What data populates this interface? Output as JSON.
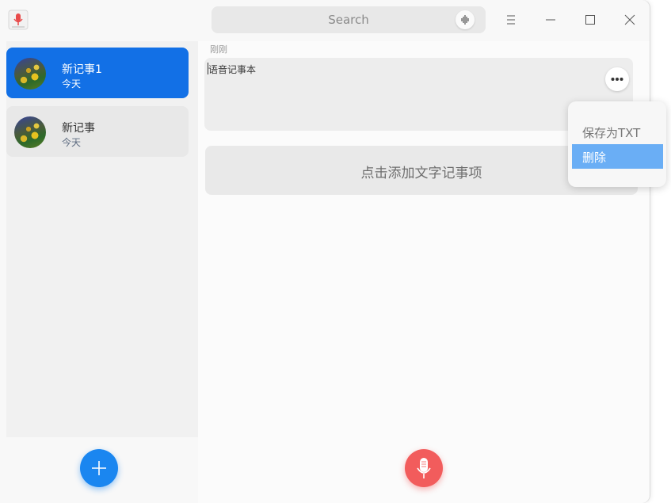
{
  "window": {
    "app_icon": "microphone-app-icon",
    "search": {
      "placeholder": "Search",
      "voice_icon": "voice-wave-icon"
    },
    "controls": [
      "menu-icon",
      "minimize-icon",
      "maximize-icon",
      "close-icon"
    ]
  },
  "sidebar": {
    "notes": [
      {
        "title": "新记事1",
        "date": "今天",
        "selected": true
      },
      {
        "title": "新记事",
        "date": "今天",
        "selected": false
      }
    ],
    "add_button_icon": "plus-icon"
  },
  "main": {
    "time_label": "刚刚",
    "voice_note_text": "语音记事本",
    "more_icon": "more-icon",
    "add_text_label": "点击添加文字记事项",
    "record_button_icon": "microphone-icon"
  },
  "context_menu": {
    "items": [
      "保存为TXT",
      "删除"
    ],
    "highlighted": "删除"
  },
  "colors": {
    "accent": "#1270e6",
    "add_button": "#1a86f0",
    "record_button": "#f25c5c",
    "menu_highlight": "#6aaef5"
  }
}
